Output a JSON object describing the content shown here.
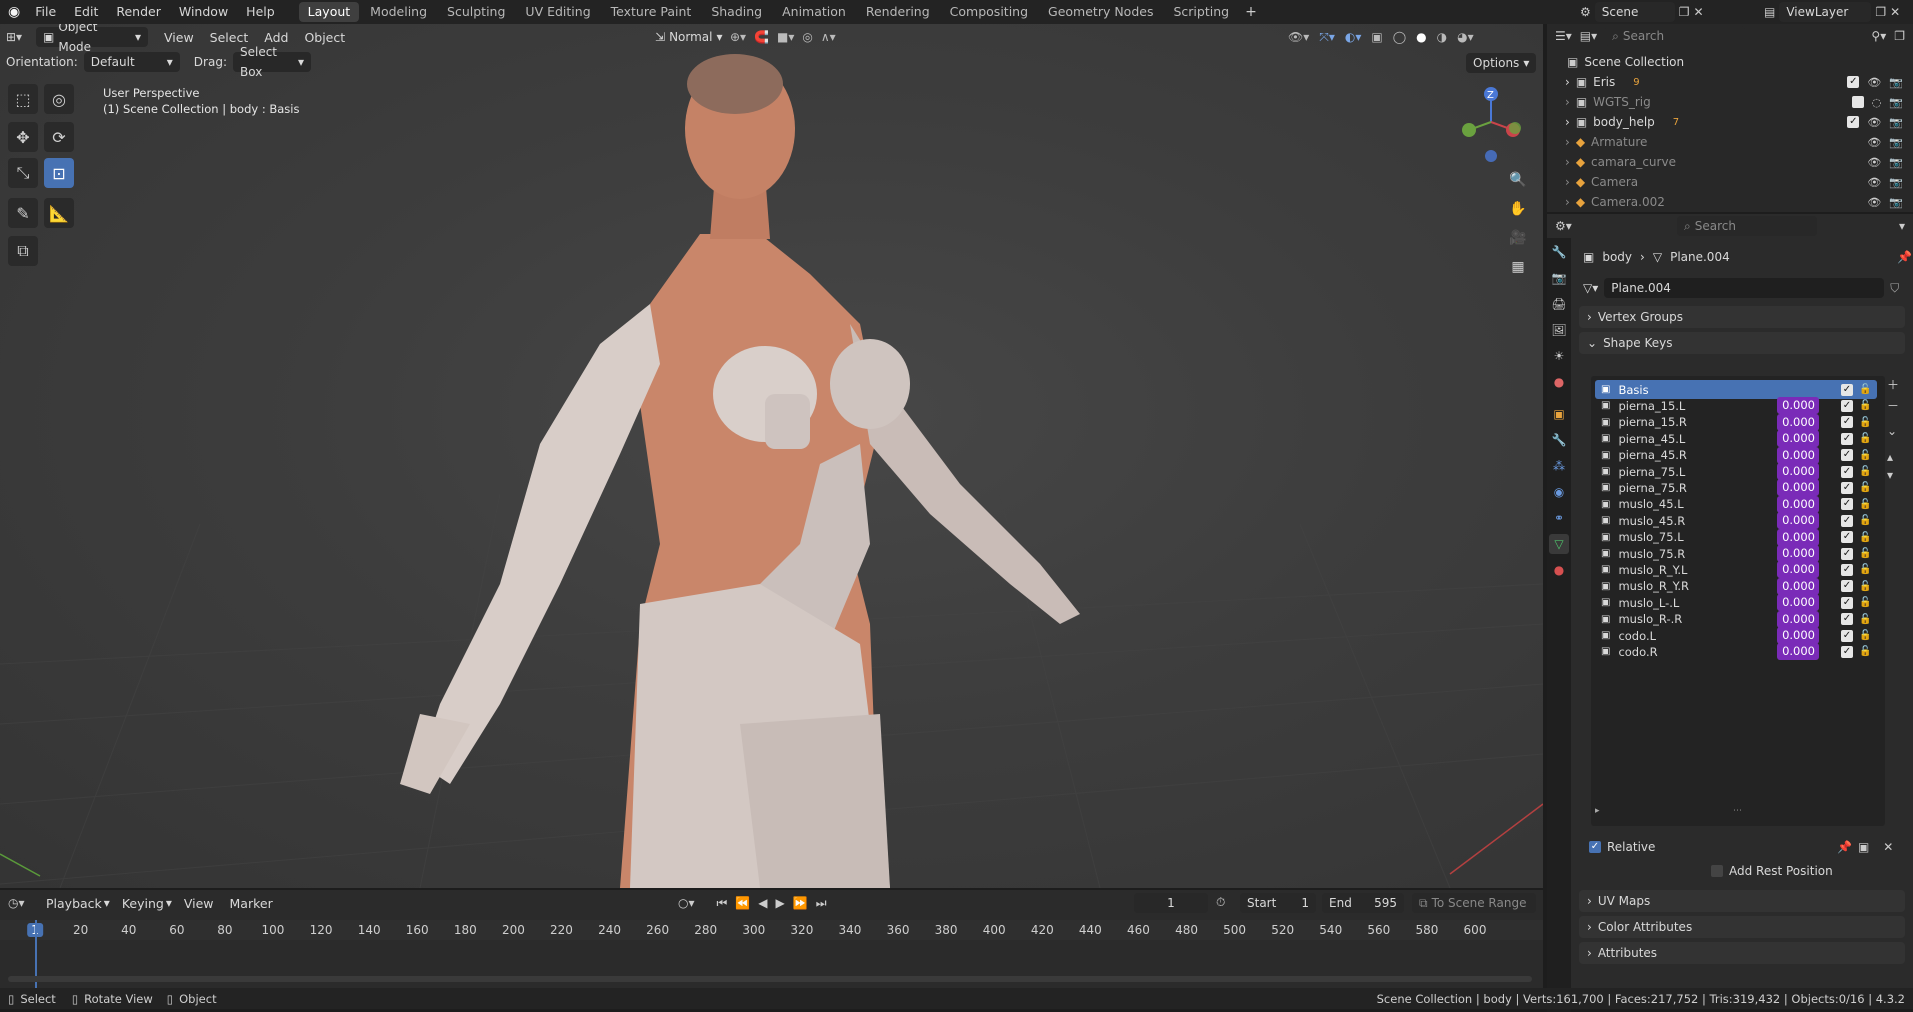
{
  "app": {
    "menu": [
      "File",
      "Edit",
      "Render",
      "Window",
      "Help"
    ],
    "workspaces": [
      "Layout",
      "Modeling",
      "Sculpting",
      "UV Editing",
      "Texture Paint",
      "Shading",
      "Animation",
      "Rendering",
      "Compositing",
      "Geometry Nodes",
      "Scripting"
    ],
    "active_workspace": "Layout",
    "add_tab": "+",
    "scene": "Scene",
    "view_layer": "ViewLayer"
  },
  "viewport": {
    "mode": "Object Mode",
    "menus": [
      "View",
      "Select",
      "Add",
      "Object"
    ],
    "transform_orientation": "Normal",
    "orientation_label": "Orientation:",
    "orientation_value": "Default",
    "drag_label": "Drag:",
    "drag_value": "Select Box",
    "options_label": "Options",
    "perspective_label": "User Perspective",
    "context_label": "(1) Scene Collection | body : Basis",
    "gizmo_z": "Z"
  },
  "outliner": {
    "search_placeholder": "Search",
    "root": "Scene Collection",
    "items": [
      {
        "name": "Eris",
        "badge": "9",
        "visible": true,
        "dim": false
      },
      {
        "name": "WGTS_rig",
        "badge": "",
        "visible": false,
        "dim": true
      },
      {
        "name": "body_help",
        "badge": "7",
        "visible": true,
        "dim": false
      },
      {
        "name": "Armature",
        "badge": "",
        "visible": true,
        "dim": true
      },
      {
        "name": "camara_curve",
        "badge": "",
        "visible": true,
        "dim": true
      },
      {
        "name": "Camera",
        "badge": "",
        "visible": true,
        "dim": true
      },
      {
        "name": "Camera.002",
        "badge": "",
        "visible": true,
        "dim": true
      }
    ]
  },
  "properties": {
    "search_placeholder": "Search",
    "breadcrumb_object": "body",
    "breadcrumb_data": "Plane.004",
    "data_name": "Plane.004",
    "panels": {
      "vertex_groups": "Vertex Groups",
      "shape_keys": "Shape Keys",
      "uv_maps": "UV Maps",
      "color_attributes": "Color Attributes",
      "attributes": "Attributes"
    },
    "shape_keys": [
      {
        "name": "Basis",
        "value": ""
      },
      {
        "name": "pierna_15.L",
        "value": "0.000"
      },
      {
        "name": "pierna_15.R",
        "value": "0.000"
      },
      {
        "name": "pierna_45.L",
        "value": "0.000"
      },
      {
        "name": "pierna_45.R",
        "value": "0.000"
      },
      {
        "name": "pierna_75.L",
        "value": "0.000"
      },
      {
        "name": "pierna_75.R",
        "value": "0.000"
      },
      {
        "name": "muslo_45.L",
        "value": "0.000"
      },
      {
        "name": "muslo_45.R",
        "value": "0.000"
      },
      {
        "name": "muslo_75.L",
        "value": "0.000"
      },
      {
        "name": "muslo_75.R",
        "value": "0.000"
      },
      {
        "name": "muslo_R_Y.L",
        "value": "0.000"
      },
      {
        "name": "muslo_R_Y.R",
        "value": "0.000"
      },
      {
        "name": "muslo_L-.L",
        "value": "0.000"
      },
      {
        "name": "muslo_R-.R",
        "value": "0.000"
      },
      {
        "name": "codo.L",
        "value": "0.000"
      },
      {
        "name": "codo.R",
        "value": "0.000"
      }
    ],
    "relative_label": "Relative",
    "add_rest_position_label": "Add Rest Position"
  },
  "timeline": {
    "menus": [
      "Playback",
      "Keying",
      "View",
      "Marker"
    ],
    "current_frame": "1",
    "start_label": "Start",
    "start_value": "1",
    "end_label": "End",
    "end_value": "595",
    "to_scene_range": "To Scene Range",
    "ruler_marks": [
      "1",
      "20",
      "40",
      "60",
      "80",
      "100",
      "120",
      "140",
      "160",
      "180",
      "200",
      "220",
      "240",
      "260",
      "280",
      "300",
      "320",
      "340",
      "360",
      "380",
      "400",
      "420",
      "440",
      "460",
      "480",
      "500",
      "520",
      "540",
      "560",
      "580",
      "600"
    ]
  },
  "statusbar": {
    "select": "Select",
    "rotate_view": "Rotate View",
    "object": "Object",
    "stats": "Scene Collection | body | Verts:161,700 | Faces:217,752 | Tris:319,432 | Objects:0/16 | 4.3.2"
  },
  "colors": {
    "accent": "#4772b3",
    "shape_value": "#7a2bb8",
    "skin": "#c9866a",
    "clay": "#d6c9c4"
  }
}
